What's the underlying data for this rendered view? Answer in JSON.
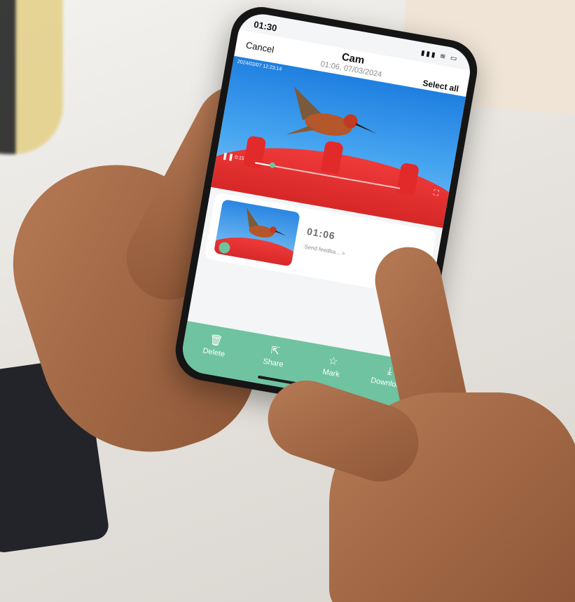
{
  "status_bar": {
    "time": "01:30",
    "signal_icon": "signal-icon",
    "wifi_icon": "wifi-icon",
    "battery_icon": "battery-icon"
  },
  "nav": {
    "cancel_label": "Cancel",
    "title": "Cam",
    "subtitle": "01:06, 07/03/2024",
    "select_all_label": "Select all"
  },
  "preview": {
    "timestamp": "2024/03/07  12:23:14",
    "playhead": "0:15",
    "progress_fraction": 0.12,
    "pause_icon": "pause-icon",
    "fullscreen_icon": "fullscreen-icon"
  },
  "clip": {
    "duration": "01:06",
    "feedback_label": "Send feedba... >",
    "species_icon": "bird-icon"
  },
  "toolbar": {
    "items": [
      {
        "label": "Delete",
        "icon": "trash-icon"
      },
      {
        "label": "Share",
        "icon": "share-icon"
      },
      {
        "label": "Mark",
        "icon": "star-icon"
      },
      {
        "label": "Download",
        "icon": "download-icon"
      }
    ]
  },
  "colors": {
    "accent": "#6fc3a0",
    "sky": "#3a9ae8",
    "feeder_red": "#e22a2a"
  }
}
